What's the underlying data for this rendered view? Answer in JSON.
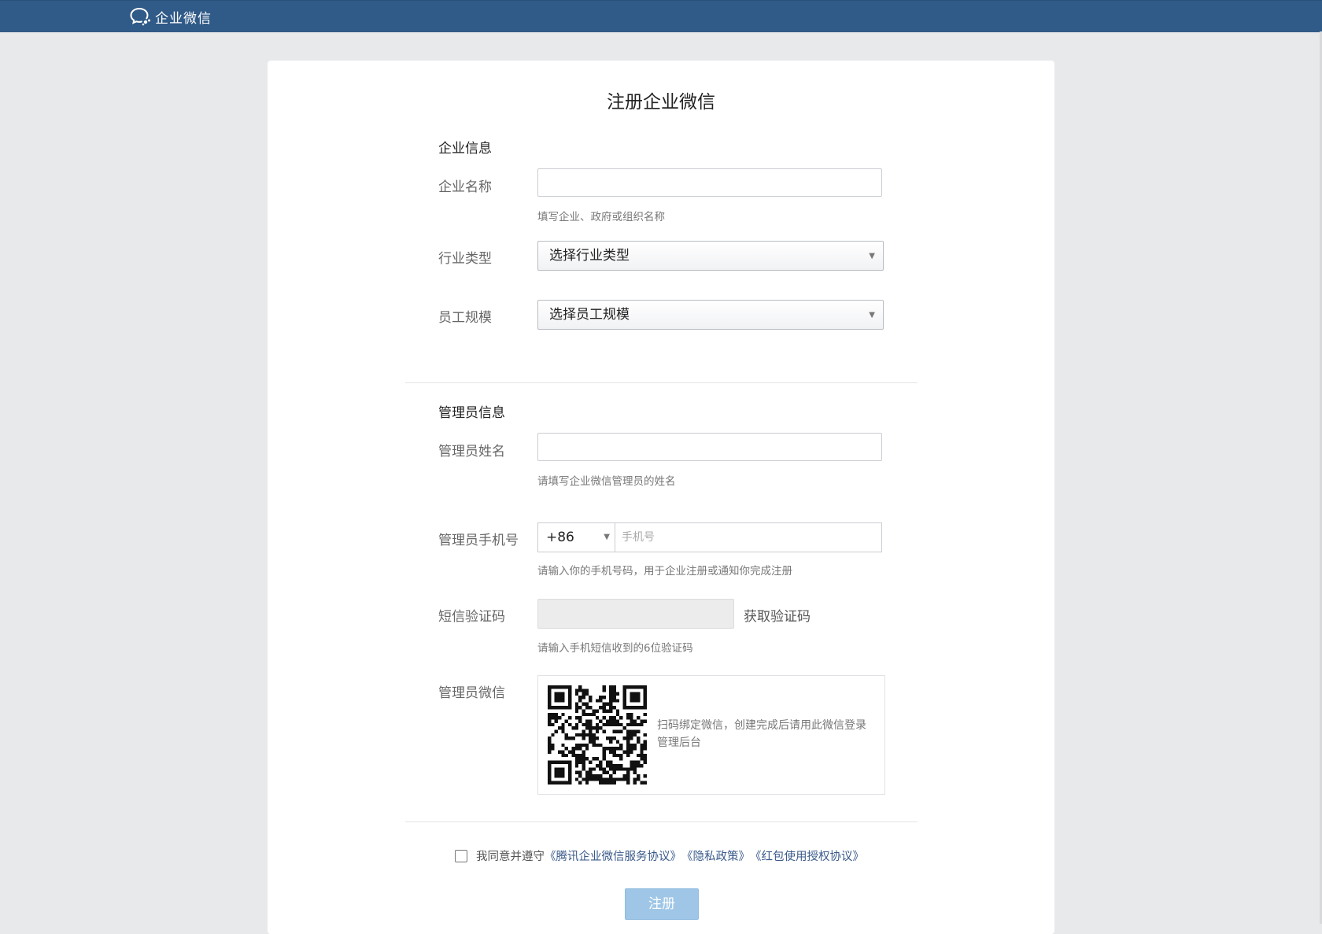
{
  "header": {
    "brand": "企业微信"
  },
  "page": {
    "title": "注册企业微信"
  },
  "company_section": {
    "title": "企业信息",
    "name_label": "企业名称",
    "name_value": "",
    "name_hint": "填写企业、政府或组织名称",
    "industry_label": "行业类型",
    "industry_value": "选择行业类型",
    "size_label": "员工规模",
    "size_value": "选择员工规模"
  },
  "admin_section": {
    "title": "管理员信息",
    "name_label": "管理员姓名",
    "name_value": "",
    "name_hint": "请填写企业微信管理员的姓名",
    "phone_label": "管理员手机号",
    "country_code": "+86",
    "phone_placeholder": "手机号",
    "phone_hint": "请输入你的手机号码，用于企业注册或通知你完成注册",
    "sms_label": "短信验证码",
    "sms_value": "",
    "sms_button": "获取验证码",
    "sms_hint": "请输入手机短信收到的6位验证码",
    "wechat_label": "管理员微信",
    "qr_text": "扫码绑定微信，创建完成后请用此微信登录管理后台"
  },
  "agreement": {
    "prefix": "我同意并遵守",
    "link1": "《腾讯企业微信服务协议》",
    "link2": "《隐私政策》",
    "link3": "《红包使用授权协议》",
    "checked": false
  },
  "actions": {
    "register_label": "注册"
  },
  "icons": {
    "brand": "wechat-work-logo-icon",
    "caret": "chevron-down-icon",
    "qr": "qr-code-icon"
  },
  "colors": {
    "topbar": "#305a87",
    "button": "#9fc6e6",
    "link": "#3a5a8a"
  }
}
